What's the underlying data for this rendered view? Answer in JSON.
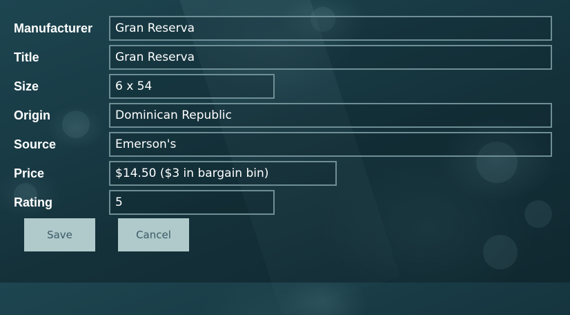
{
  "form": {
    "fields": [
      {
        "label": "Manufacturer",
        "value": "Gran Reserva"
      },
      {
        "label": "Title",
        "value": "Gran Reserva"
      },
      {
        "label": "Size",
        "value": "6 x 54"
      },
      {
        "label": "Origin",
        "value": "Dominican Republic"
      },
      {
        "label": "Source",
        "value": "Emerson's"
      },
      {
        "label": "Price",
        "value": "$14.50 ($3 in bargain bin)"
      },
      {
        "label": "Rating",
        "value": "5"
      }
    ],
    "buttons": {
      "save_label": "Save",
      "cancel_label": "Cancel"
    }
  },
  "colors": {
    "background": "#183a44",
    "field_border": "#6f8f96",
    "button_bg": "#b0c9ca",
    "button_text": "#3a5a66",
    "text": "#ffffff"
  }
}
